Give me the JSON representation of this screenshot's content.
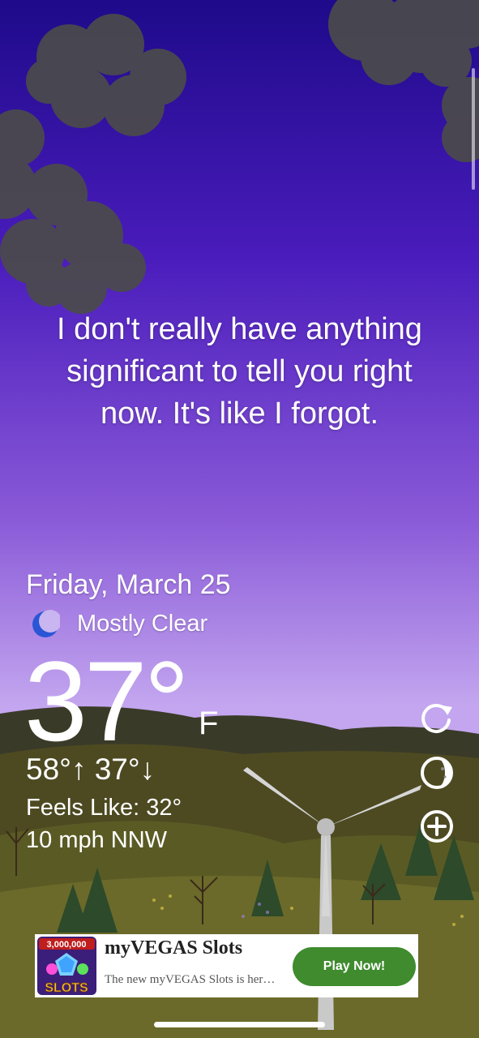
{
  "message": {
    "line1": "I don't really have anything",
    "line2": "significant to tell you right",
    "line3": "now. It's like I forgot."
  },
  "weather": {
    "date": "Friday, March 25",
    "condition": "Mostly Clear",
    "condition_icon": "moon-icon",
    "temperature": "37°",
    "unit": "F",
    "high_low": "58°↑ 37°↓",
    "feels_like": "Feels Like: 32°",
    "wind": "10 mph NNW"
  },
  "controls": {
    "refresh_icon": "refresh-icon",
    "theme_icon": "moon-phase-icon",
    "add_icon": "add-circle-icon"
  },
  "ad": {
    "badge": "3,000,000",
    "icon_text": "SLOTS",
    "title": "myVEGAS Slots",
    "description": "The new myVEGAS Slots is her…",
    "cta": "Play Now!",
    "cta_color": "#3f8b2e"
  },
  "colors": {
    "sky_top": "#1e0a8a",
    "sky_mid": "#7f4fd6",
    "sky_low": "#c6a8ef",
    "hills": "#3b3d1f"
  }
}
